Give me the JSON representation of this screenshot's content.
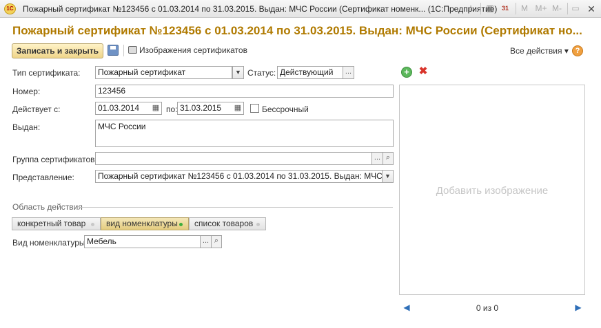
{
  "window": {
    "title": "Пожарный сертификат №123456 с 01.03.2014 по 31.03.2015. Выдан: МЧС России (Сертификат номенк...  (1С:Предприятие)",
    "logo_text": "1С",
    "toolbar_icons": [
      "favorite-star-icon",
      "calculator-icon",
      "calendar-icon",
      "memory-m-icon",
      "memory-plus-icon",
      "memory-minus-icon",
      "close-icon"
    ],
    "m_label": "M",
    "m_plus_label": "M+",
    "m_minus_label": "M-",
    "calendar_label": "31"
  },
  "header": {
    "title": "Пожарный сертификат №123456 с 01.03.2014 по 31.03.2015. Выдан: МЧС России (Сертификат но..."
  },
  "toolbar": {
    "save_close_label": "Записать и закрыть",
    "images_label": "Изображения сертификатов",
    "all_actions_label": "Все действия",
    "all_actions_arrow": "▾",
    "help_label": "?"
  },
  "form": {
    "type_label": "Тип сертификата:",
    "type_value": "Пожарный сертификат",
    "status_label": "Статус:",
    "status_value": "Действующий",
    "number_label": "Номер:",
    "number_value": "123456",
    "valid_from_label": "Действует с:",
    "valid_from_value": "01.03.2014",
    "valid_to_label": "по:",
    "valid_to_value": "31.03.2015",
    "indefinite_label": "Бессрочный",
    "indefinite_checked": false,
    "issued_label": "Выдан:",
    "issued_value": "МЧС России",
    "group_label": "Группа сертификатов:",
    "group_value": "",
    "representation_label": "Представление:",
    "representation_value": "Пожарный сертификат №123456 с 01.03.2014 по 31.03.2015. Выдан: МЧС России",
    "ellipsis": "...",
    "dropdown_arrow": "▼"
  },
  "scope": {
    "section_title": "Область действия",
    "switch_options": [
      {
        "label": "конкретный товар",
        "selected": false
      },
      {
        "label": "вид номенклатуры",
        "selected": true
      },
      {
        "label": "список товаров",
        "selected": false
      }
    ],
    "nomenclature_label": "Вид номенклатуры:",
    "nomenclature_value": "Мебель"
  },
  "images": {
    "placeholder": "Добавить изображение",
    "pager_text": "0 из 0",
    "add_icon": "+",
    "delete_icon": "✖",
    "prev_icon": "◀",
    "next_icon": "▶"
  },
  "colors": {
    "heading": "#b07a00",
    "primary_button": "#efd58a",
    "selected_switch": "#e4cc7e",
    "active_dot": "#3cae3c"
  }
}
